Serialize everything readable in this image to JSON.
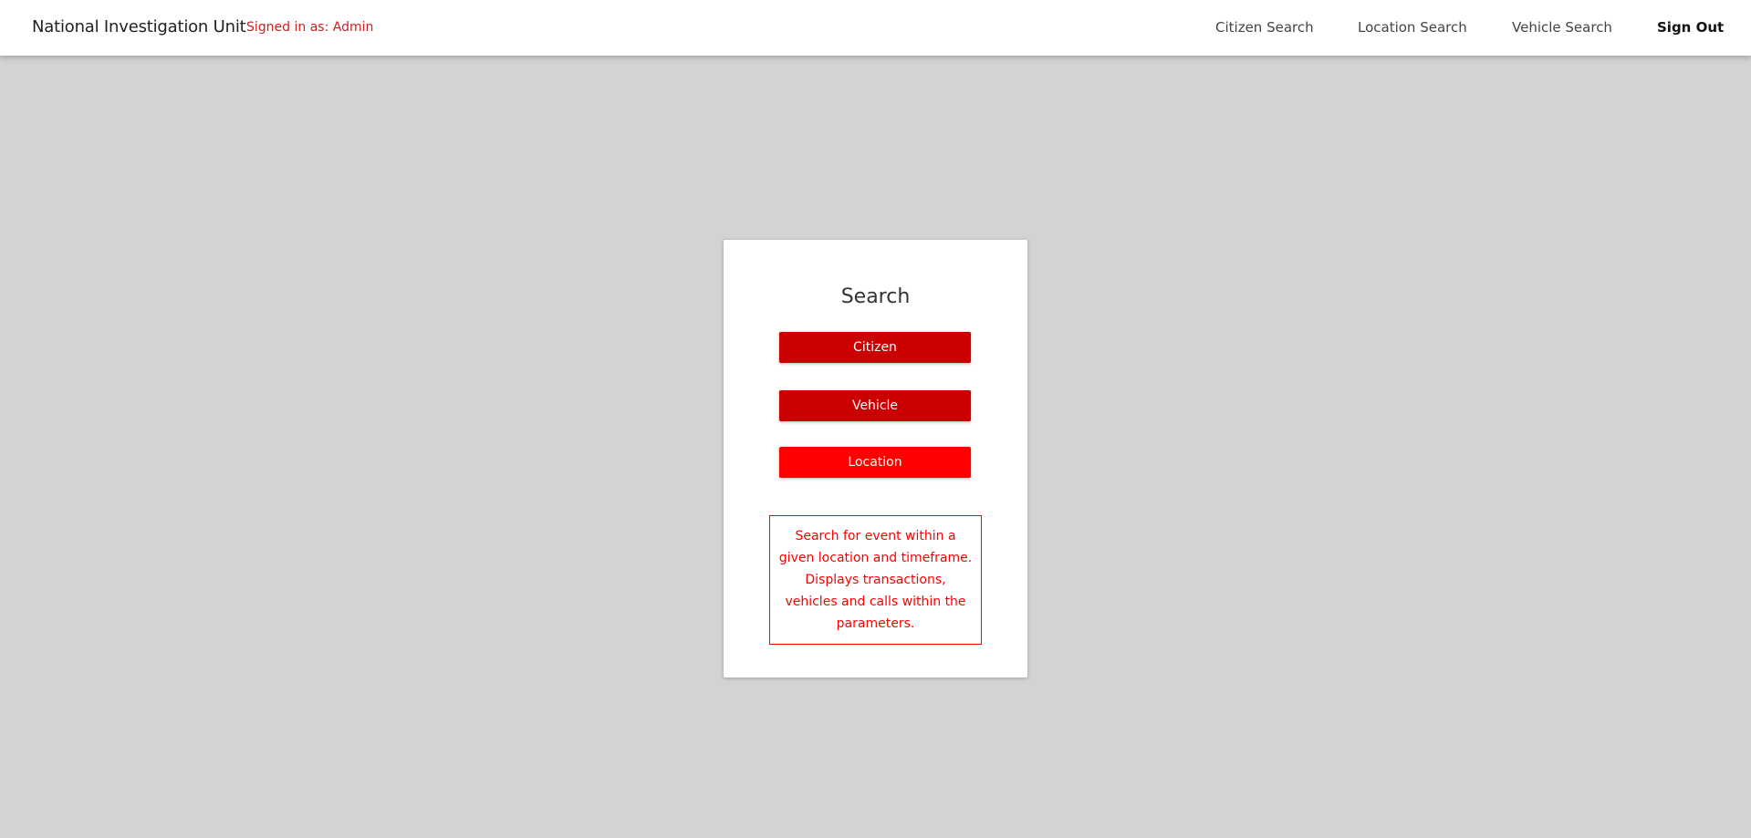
{
  "header": {
    "brand": "National Investigation Unit",
    "signed_in": "Signed in as: Admin",
    "nav": {
      "citizen_search": "Citizen Search",
      "location_search": "Location Search",
      "vehicle_search": "Vehicle Search",
      "sign_out": "Sign Out"
    }
  },
  "search_card": {
    "title": "Search",
    "buttons": {
      "citizen": "Citizen",
      "vehicle": "Vehicle",
      "location": "Location"
    },
    "description": "Search for event within a given location and timeframe. Displays transactions, vehicles and calls within the parameters."
  },
  "colors": {
    "background": "#d3d3d3",
    "accent_dark": "#cc0000",
    "accent_bright": "#ff0000",
    "signed_in_text": "#cc1f1f"
  }
}
